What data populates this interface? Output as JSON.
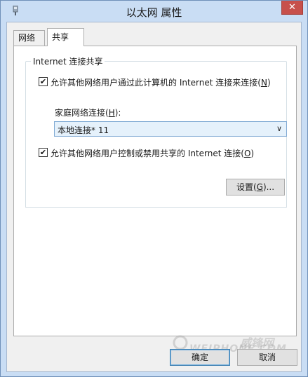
{
  "window": {
    "title": "以太网 属性",
    "close_label": "✕"
  },
  "tabs": [
    {
      "label": "网络",
      "active": false
    },
    {
      "label": "共享",
      "active": true
    }
  ],
  "group": {
    "legend": "Internet 连接共享"
  },
  "allow_share": {
    "checked": true,
    "label_before": "允许其他网络用户通过此计算机的 Internet 连接来连接(",
    "mnemonic": "N",
    "label_after": ")"
  },
  "home_network": {
    "label_before": "家庭网络连接(",
    "mnemonic": "H",
    "label_after": "):",
    "selected": "本地连接* 11"
  },
  "allow_control": {
    "checked": true,
    "label_before": "允许其他网络用户控制或禁用共享的 Internet 连接(",
    "mnemonic": "O",
    "label_after": ")"
  },
  "settings_button": {
    "label_before": "设置(",
    "mnemonic": "G",
    "label_after": ")..."
  },
  "buttons": {
    "ok": "确定",
    "cancel": "取消"
  },
  "watermark": {
    "cn": "威锋网",
    "en": "WEIPHONE.COM"
  },
  "colors": {
    "titlebar": "#c9ddf4",
    "close": "#c7504b",
    "combo_bg": "#e5f1fb"
  }
}
